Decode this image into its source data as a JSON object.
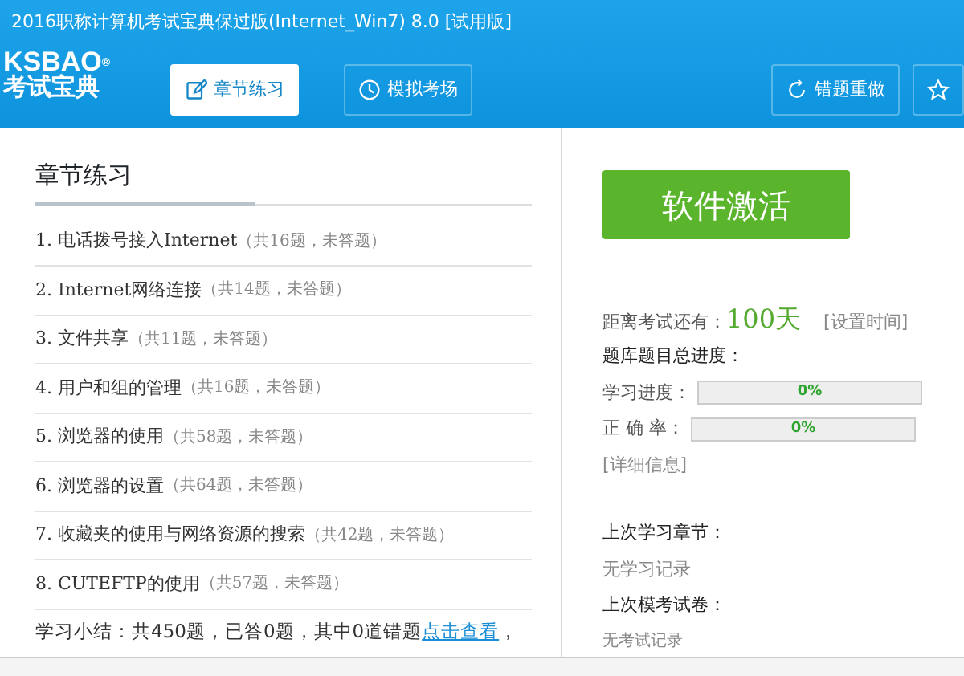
{
  "window": {
    "title": "2016职称计算机考试宝典保过版(Internet_Win7) 8.0 [试用版]"
  },
  "logo": {
    "top": "KSBAO",
    "mark": "®",
    "bottom": "考试宝典"
  },
  "tabs": [
    {
      "label": "章节练习",
      "selected": true
    },
    {
      "label": "模拟考场",
      "selected": false
    },
    {
      "label": "错题重做",
      "selected": false
    },
    {
      "selected": false
    }
  ],
  "chapters": {
    "title": "章节练习",
    "items": [
      {
        "name": "1. 电话拨号接入Internet",
        "info": "（共16题，未答题）"
      },
      {
        "name": "2. Internet网络连接",
        "info": "（共14题，未答题）"
      },
      {
        "name": "3. 文件共享",
        "info": "（共11题，未答题）"
      },
      {
        "name": "4. 用户和组的管理",
        "info": "（共16题，未答题）"
      },
      {
        "name": "5. 浏览器的使用",
        "info": "（共58题，未答题）"
      },
      {
        "name": "6. 浏览器的设置",
        "info": "（共64题，未答题）"
      },
      {
        "name": "7. 收藏夹的使用与网络资源的搜索",
        "info": "（共42题，未答题）"
      },
      {
        "name": "8. CUTEFTP的使用",
        "info": "（共57题，未答题）"
      }
    ],
    "summary": "学习小结：共450题，已答0题，其中0道错题",
    "summary_link": "点击查看",
    "summary_end": "，"
  },
  "side": {
    "activate_button": "软件激活",
    "countdown_label": "距离考试还有：",
    "countdown_value": "100天",
    "set_time_link": "[设置时间]",
    "progress_title": "题库题目总进度：",
    "meters": [
      {
        "label": "学习进度：",
        "level": 0,
        "reading": "0%"
      },
      {
        "label": "正 确 率：",
        "level": 0,
        "reading": "0%"
      }
    ],
    "details_link": "[详细信息]",
    "last_chapter_title": "上次学习章节：",
    "last_chapter_value": "无学习记录",
    "last_exam_title": "上次模考试卷：",
    "last_exam_value": "无考试记录"
  }
}
